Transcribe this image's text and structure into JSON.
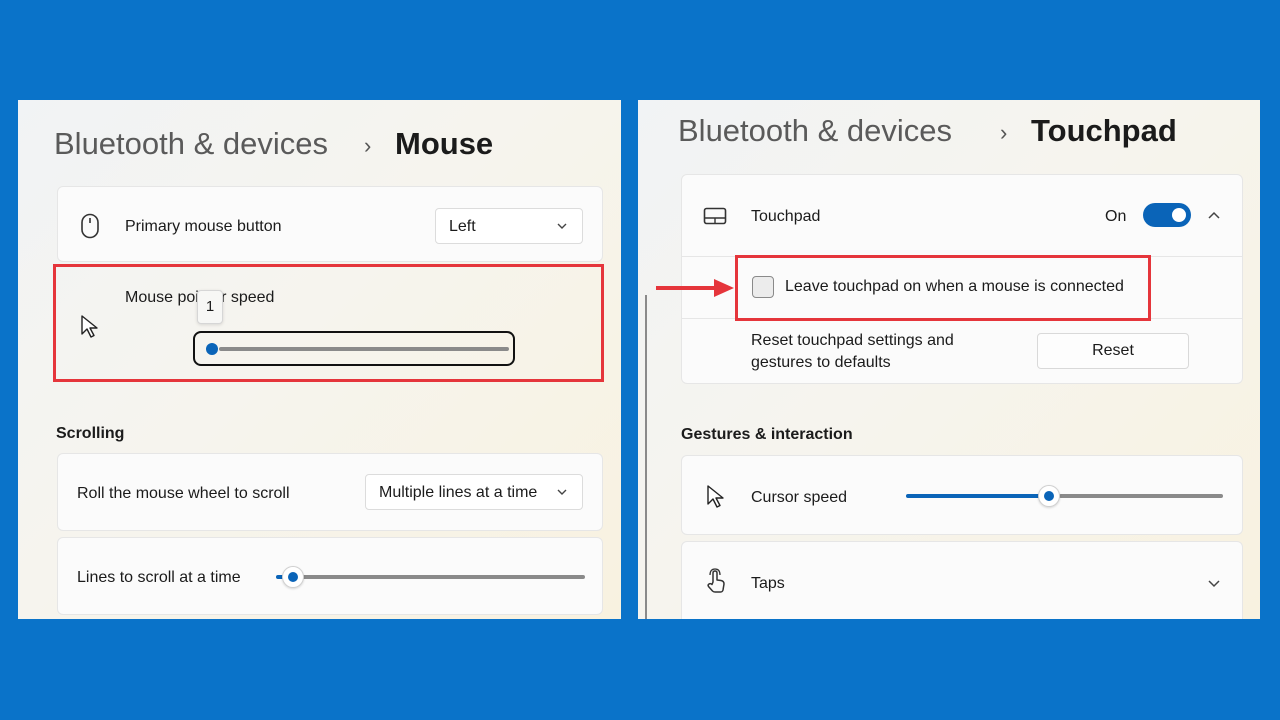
{
  "colors": {
    "background": "#0A73C9",
    "accent": "#0A64B8",
    "highlight": "#E5353B"
  },
  "mouse_panel": {
    "breadcrumb": {
      "parent": "Bluetooth & devices",
      "separator": "›",
      "current": "Mouse"
    },
    "primary_button": {
      "icon": "mouse-icon",
      "label": "Primary mouse button",
      "value": "Left"
    },
    "pointer_speed": {
      "label": "Mouse pointer speed",
      "tooltip": "1",
      "value": 1
    },
    "scrolling": {
      "heading": "Scrolling",
      "roll_wheel": {
        "label": "Roll the mouse wheel to scroll",
        "value": "Multiple lines at a time"
      },
      "lines": {
        "label": "Lines to scroll at a time",
        "value_fraction": 0.04
      }
    }
  },
  "touchpad_panel": {
    "breadcrumb": {
      "parent": "Bluetooth & devices",
      "separator": "›",
      "current": "Touchpad"
    },
    "touchpad": {
      "icon": "touchpad-icon",
      "label": "Touchpad",
      "state": "On",
      "toggle_on": true,
      "expanded": true
    },
    "leave_on": {
      "label": "Leave touchpad on when a mouse is connected",
      "checked": false
    },
    "reset": {
      "label_line1": "Reset touchpad settings and",
      "label_line2": "gestures to defaults",
      "button": "Reset"
    },
    "gestures": {
      "heading": "Gestures & interaction",
      "cursor_speed": {
        "icon": "cursor-icon",
        "label": "Cursor speed",
        "value_fraction": 0.45
      },
      "taps": {
        "icon": "tap-icon",
        "label": "Taps"
      }
    }
  }
}
